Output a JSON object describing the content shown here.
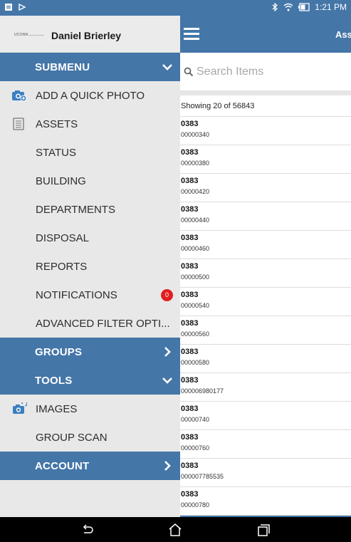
{
  "status_bar": {
    "time": "1:21 PM",
    "icons": [
      "notification-icon",
      "cast-icon",
      "bluetooth-icon",
      "wifi-icon",
      "battery-icon"
    ]
  },
  "main": {
    "header_title": "Ass",
    "search": {
      "placeholder": "Search Items",
      "value": ""
    },
    "showing": "Showing 20 of 56843",
    "items": [
      {
        "title": "0383",
        "sub": "00000340"
      },
      {
        "title": "0383",
        "sub": "00000380"
      },
      {
        "title": "0383",
        "sub": "00000420"
      },
      {
        "title": "0383",
        "sub": "00000440"
      },
      {
        "title": "0383",
        "sub": "00000460"
      },
      {
        "title": "0383",
        "sub": "00000500"
      },
      {
        "title": "0383",
        "sub": "00000540"
      },
      {
        "title": "0383",
        "sub": "00000560"
      },
      {
        "title": "0383",
        "sub": "00000580"
      },
      {
        "title": "0383",
        "sub": "000006980177"
      },
      {
        "title": "0383",
        "sub": "00000740"
      },
      {
        "title": "0383",
        "sub": "00000760"
      },
      {
        "title": "0383",
        "sub": "000007785535"
      },
      {
        "title": "0383",
        "sub": "00000780"
      }
    ]
  },
  "drawer": {
    "logo_text": "UCONN",
    "user_name": "Daniel Brierley",
    "submenu_label": "SUBMENU",
    "add_quick_photo": "ADD A QUICK PHOTO",
    "assets": "ASSETS",
    "status": "STATUS",
    "building": "BUILDING",
    "departments": "DEPARTMENTS",
    "disposal": "DISPOSAL",
    "reports": "REPORTS",
    "notifications": "NOTIFICATIONS",
    "notifications_count": "0",
    "advanced_filter": "ADVANCED FILTER OPTI...",
    "groups_label": "GROUPS",
    "tools_label": "TOOLS",
    "images": "IMAGES",
    "group_scan": "GROUP SCAN",
    "account_label": "ACCOUNT"
  },
  "colors": {
    "primary": "#4476a8",
    "drawer_bg": "#e8e8e8",
    "badge": "#e02020",
    "icon_blue": "#3a7fc1"
  }
}
